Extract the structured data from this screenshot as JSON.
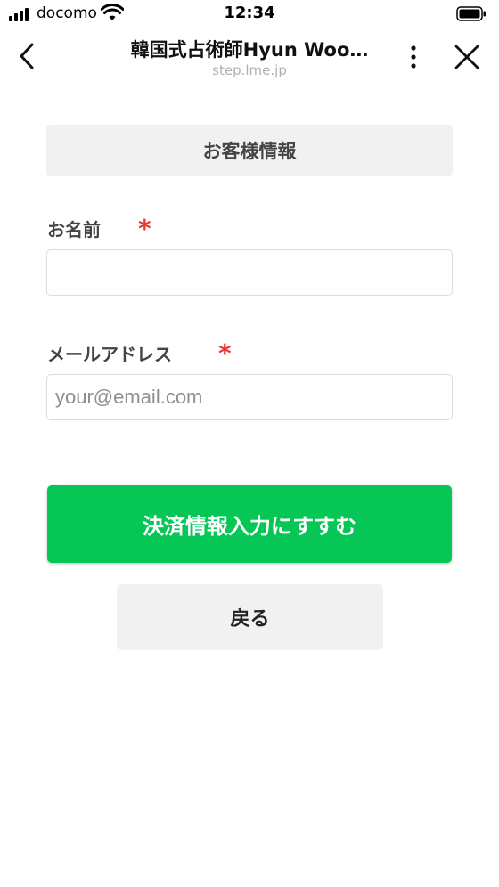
{
  "status_bar": {
    "carrier": "docomo",
    "time": "12:34"
  },
  "nav": {
    "title": "韓国式占術師Hyun Woo…",
    "subtitle": "step.lme.jp"
  },
  "form": {
    "section_title": "お客様情報",
    "name_label": "お名前",
    "name_required_mark": "*",
    "name_value": "",
    "email_label": "メールアドレス",
    "email_required_mark": "*",
    "email_placeholder": "your@email.com",
    "submit_label": "決済情報入力にすすむ",
    "back_label": "戻る"
  },
  "colors": {
    "primary": "#06c755",
    "required": "#e53935",
    "section_bg": "#f1f1f1"
  }
}
